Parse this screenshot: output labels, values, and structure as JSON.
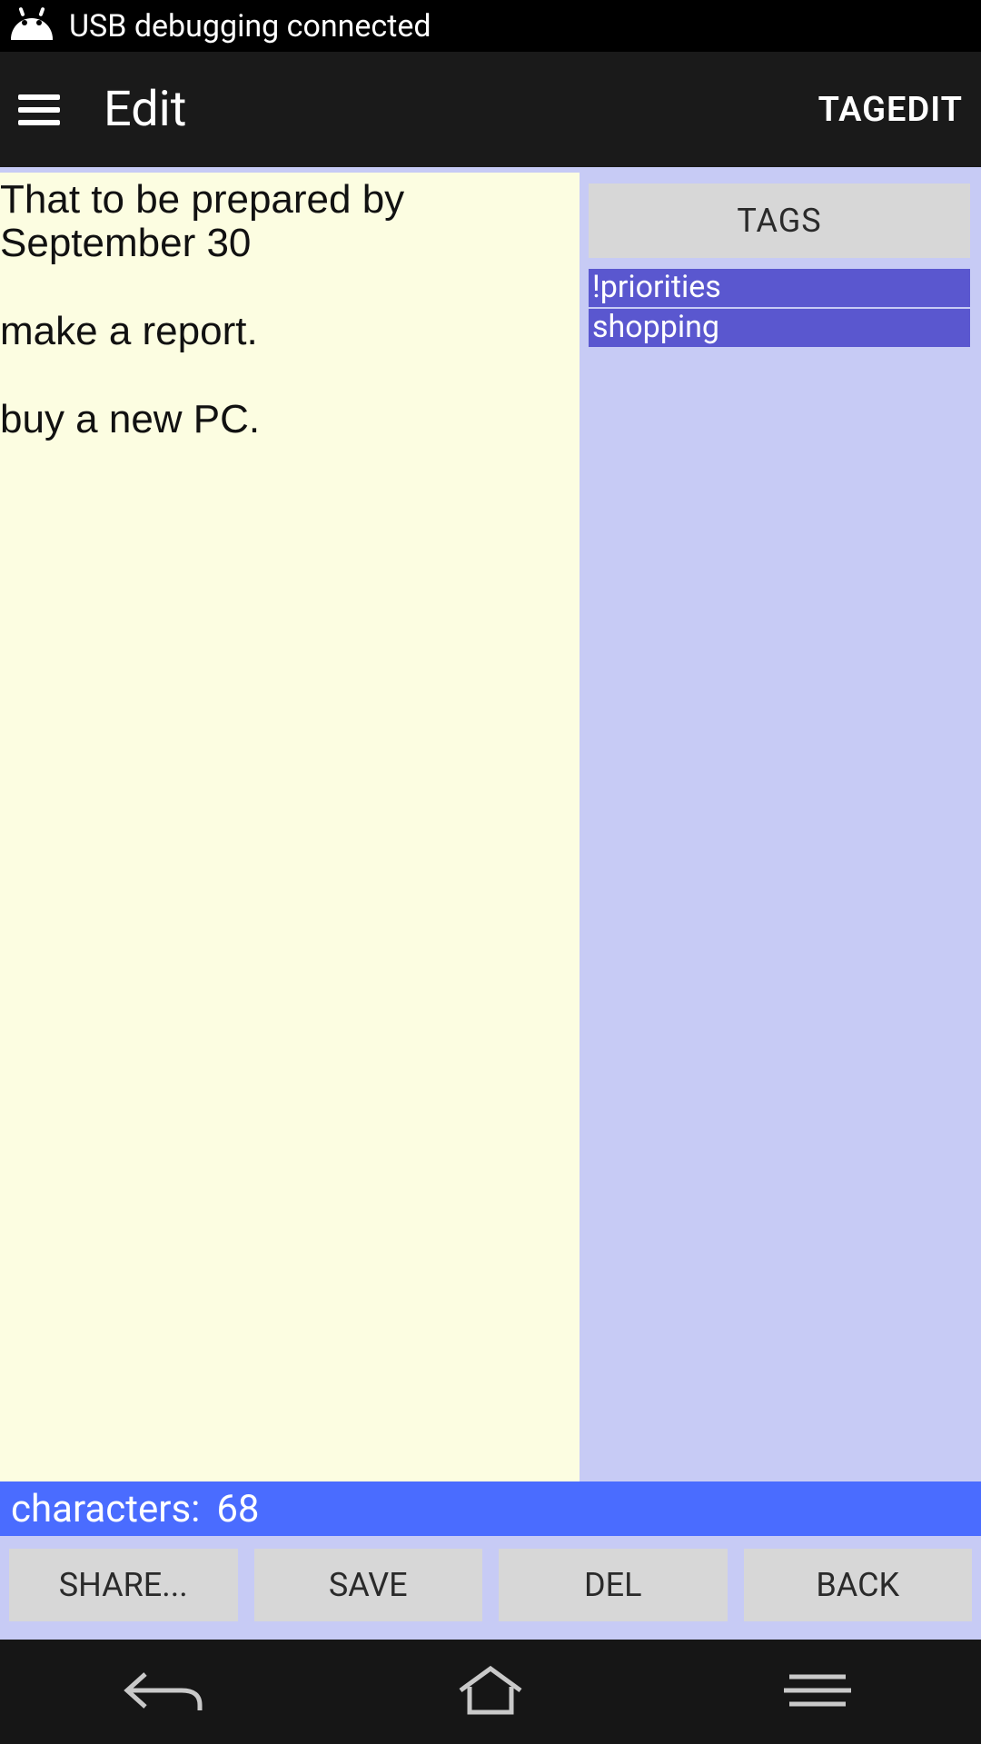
{
  "status_bar": {
    "text": "USB debugging connected"
  },
  "header": {
    "title": "Edit",
    "tagedit_label": "TAGEDIT"
  },
  "note": {
    "content": "That to be prepared by September 30\n\nmake a report.\n\nbuy a new PC."
  },
  "sidebar": {
    "tags_label": "TAGS",
    "tags": [
      "!priorities",
      "shopping"
    ]
  },
  "char_counter": {
    "label": "characters:",
    "value": "68"
  },
  "buttons": {
    "share_label": "SHARE...",
    "save_label": "SAVE",
    "del_label": "DEL",
    "back_label": "BACK"
  }
}
